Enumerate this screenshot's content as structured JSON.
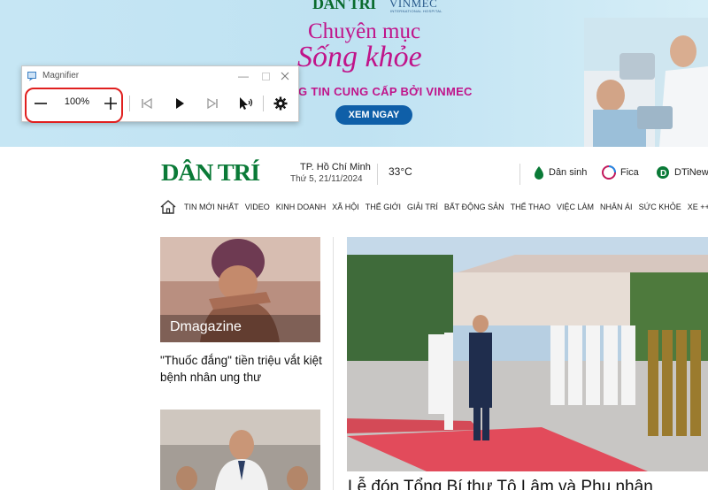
{
  "banner": {
    "logo_dantri": "DÂN TRÍ",
    "logo_vinmec": "VINMEC",
    "logo_vinmec_sub": "INTERNATIONAL HOSPITAL",
    "title_line1": "Chuyên mục",
    "title_line2": "Sống khỏe",
    "subtitle": "G TIN CUNG CẤP BỞI VINMEC",
    "cta": "XEM NGAY"
  },
  "magnifier": {
    "title": "Magnifier",
    "zoom_level": "100%",
    "icons": [
      "magnifier-app-icon",
      "minimize-icon",
      "maximize-icon",
      "close-icon",
      "zoom-out-icon",
      "zoom-in-icon",
      "previous-icon",
      "play-icon",
      "next-icon",
      "read-from-here-icon",
      "settings-icon"
    ]
  },
  "header": {
    "logo": "DÂN TRÍ",
    "location": "TP. Hồ Chí Minh",
    "date": "Thứ 5, 21/11/2024",
    "temperature": "33°C",
    "quick_links": [
      "Dân sinh",
      "Fica",
      "DTiNews"
    ]
  },
  "nav": {
    "items": [
      "TIN MỚI NHẤT",
      "VIDEO",
      "KINH DOANH",
      "XÃ HỘI",
      "THẾ GIỚI",
      "GIẢI TRÍ",
      "BẤT ĐỘNG SẢN",
      "THỂ THAO",
      "VIỆC LÀM",
      "NHÂN ÁI",
      "SỨC KHỎE",
      "XE ++"
    ]
  },
  "articles": {
    "card1": {
      "badge": "Dmagazine",
      "title": "\"Thuốc đắng\" tiền triệu vắt kiệt bệnh nhân ung thư"
    },
    "main": {
      "title": "Lễ đón Tổng Bí thư Tô Lâm và Phu nhân"
    }
  },
  "colors": {
    "brand_green": "#0a7a37",
    "banner_magenta": "#c0148a",
    "cta_blue": "#0f5fa8",
    "highlight_red": "#e0201f"
  }
}
